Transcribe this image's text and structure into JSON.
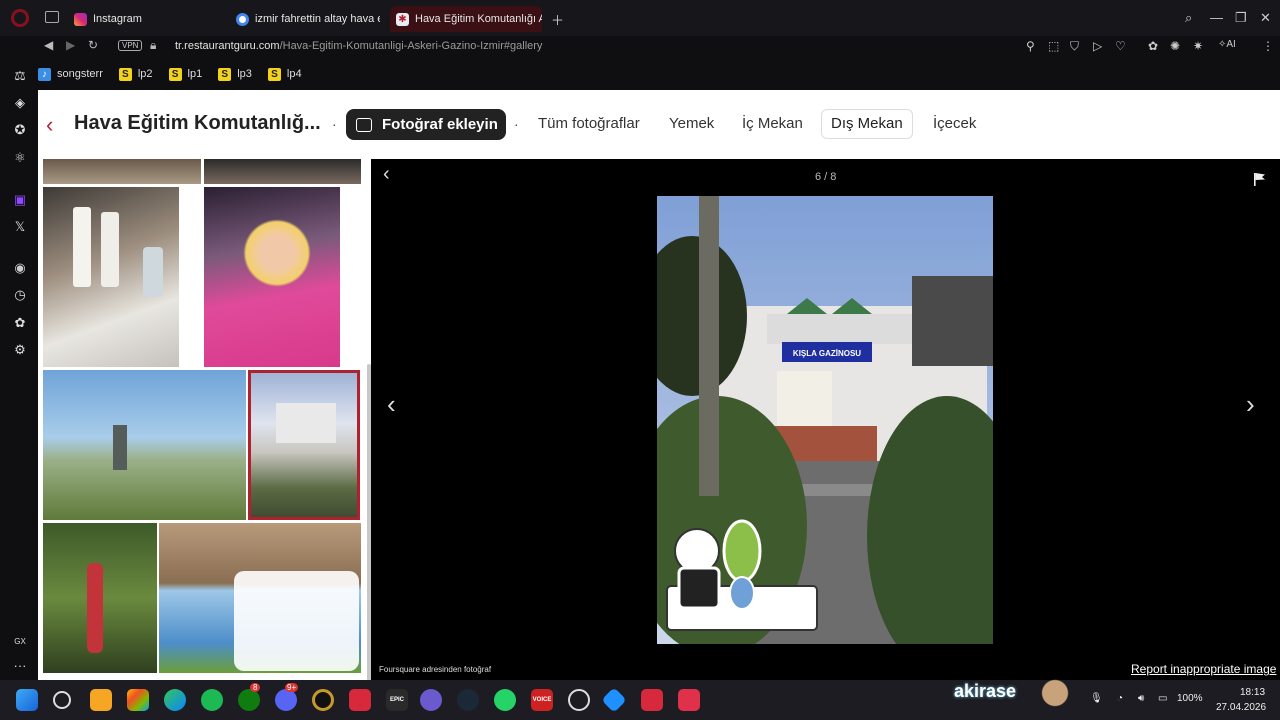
{
  "tabs": [
    {
      "label": "Instagram",
      "active": false
    },
    {
      "label": "izmir fahrettin altay hava e",
      "active": false
    },
    {
      "label": "Hava Eğitim Komutanlığı A",
      "active": true
    }
  ],
  "address": {
    "vpn_label": "VPN",
    "url_domain": "tr.restaurantguru.com",
    "url_path": "/Hava-Egitim-Komutanligi-Askeri-Gazino-Izmir#gallery",
    "ai_label": "AI"
  },
  "bookmarks": [
    {
      "label": "songsterr"
    },
    {
      "label": "lp2"
    },
    {
      "label": "lp1"
    },
    {
      "label": "lp3"
    },
    {
      "label": "lp4"
    }
  ],
  "sidebar": {
    "gx_label": "GX",
    "more_label": "···"
  },
  "page": {
    "restaurant_name": "Hava Eğitim Komutanlığ...",
    "add_photo_label": "Fotoğraf ekleyin",
    "categories": [
      {
        "label": "Tüm fotoğraflar",
        "selected": false
      },
      {
        "label": "Yemek",
        "selected": false
      },
      {
        "label": "İç Mekan",
        "selected": false
      },
      {
        "label": "Dış Mekan",
        "selected": true
      },
      {
        "label": "İçecek",
        "selected": false
      }
    ]
  },
  "viewer": {
    "counter": "6 / 8",
    "credit": "Foursquare adresinden fotoğraf",
    "report_label": "Report inappropriate image",
    "sign_text": "KIŞLA GAZİNOSU"
  },
  "taskbar": {
    "akirase_label": "akirase",
    "battery": "100%",
    "time": "18:13",
    "date": "27.04.2026",
    "xbox_badge": "8",
    "discord_badge": "9+",
    "epic_label": "EPIC",
    "voicemeeter_label": "VOICE"
  },
  "colors": {
    "accent": "#b0212f",
    "page_bg": "#ffffff",
    "viewer_bg": "#000000",
    "chrome_bg": "#17171b"
  }
}
